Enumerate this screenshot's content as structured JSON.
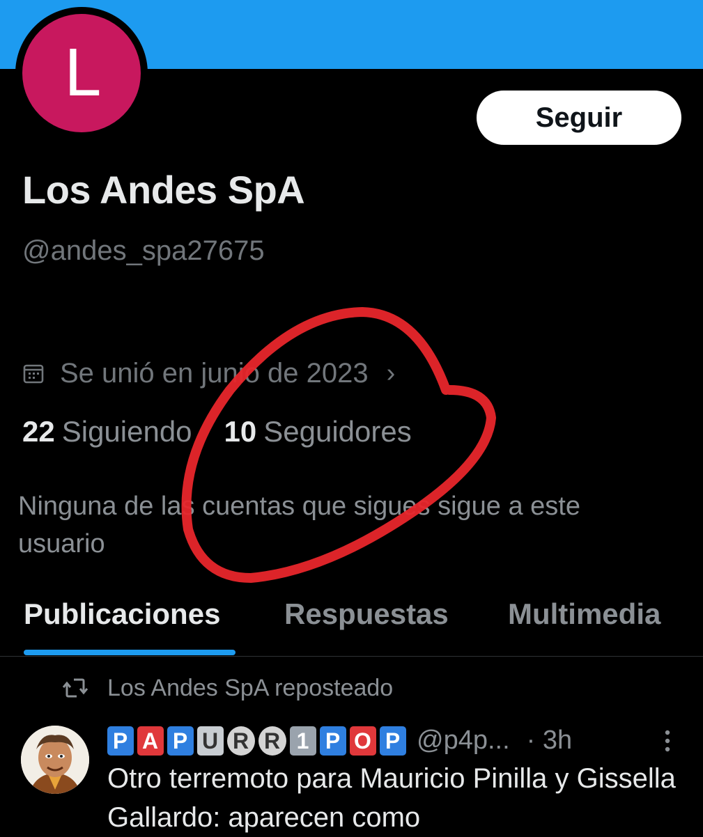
{
  "profile": {
    "avatar_letter": "L",
    "avatar_color": "#c8185e",
    "banner_color": "#1d9bf0",
    "follow_label": "Seguir",
    "name": "Los Andes SpA",
    "handle": "@andes_spa27675",
    "joined": "Se unió en junio de 2023",
    "following_count": "22",
    "following_label": "Siguiendo",
    "followers_count": "10",
    "followers_label": "Seguidores",
    "mutuals_notice": "Ninguna de las cuentas que sigues sigue a este usuario"
  },
  "tabs": [
    {
      "label": "Publicaciones",
      "active": true
    },
    {
      "label": "Respuestas",
      "active": false
    },
    {
      "label": "Multimedia",
      "active": false
    }
  ],
  "feed": {
    "repost_label": "Los Andes SpA reposteado",
    "post": {
      "author_badges": [
        "P",
        "A",
        "P",
        "U",
        "R",
        "R",
        "1",
        "P",
        "O",
        "P"
      ],
      "handle": "@p4p...",
      "time": "· 3h",
      "text": "Otro terremoto para Mauricio Pinilla y Gissella Gallardo: aparecen como"
    }
  },
  "annotation": {
    "color": "#e8262b",
    "shape": "hand-drawn circle"
  },
  "icons": [
    "calendar-icon",
    "chevron-right-icon",
    "repost-icon",
    "more-vertical-icon"
  ]
}
